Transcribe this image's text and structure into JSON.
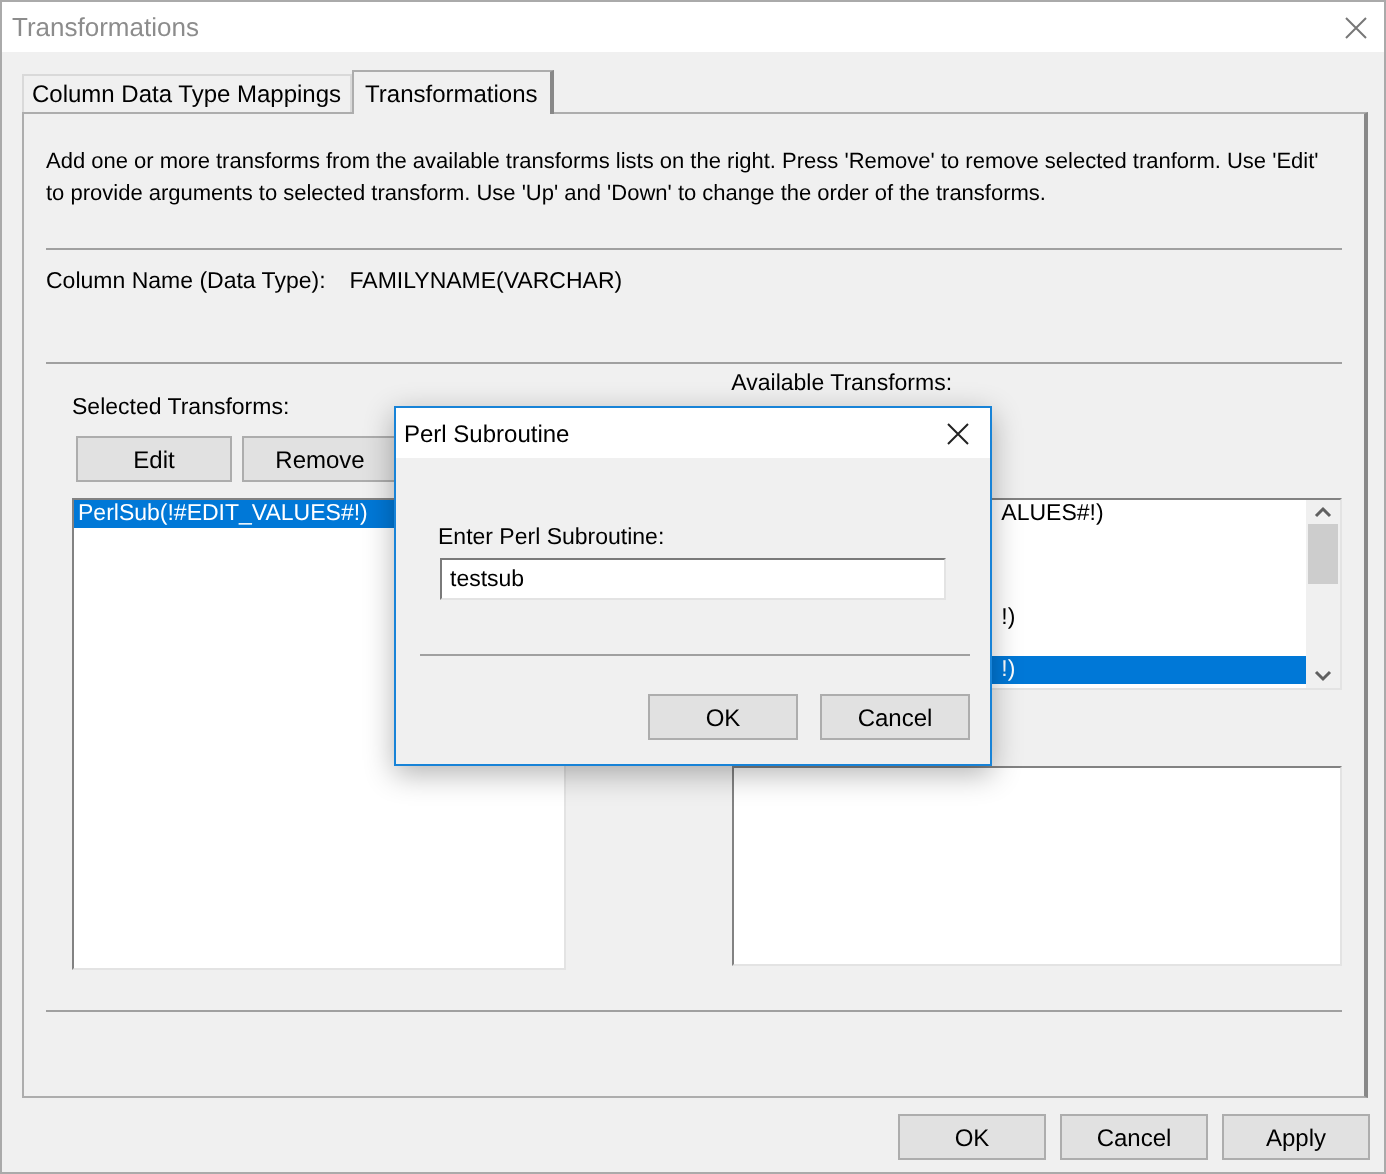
{
  "window": {
    "title": "Transformations"
  },
  "tabs": [
    {
      "label": "Column Data Type Mappings",
      "selected": false
    },
    {
      "label": "Transformations",
      "selected": true
    }
  ],
  "description": "Add one or more transforms from the available transforms lists on the right. Press 'Remove' to remove selected tranform. Use 'Edit' to provide arguments to selected transform. Use 'Up' and 'Down' to change the order of the transforms.",
  "column_name": {
    "label": "Column Name (Data Type):",
    "value": "FAMILYNAME(VARCHAR)"
  },
  "selected_transforms": {
    "label": "Selected Transforms:",
    "buttons": [
      "Edit",
      "Remove"
    ],
    "items": [
      {
        "label": "PerlSub(!#EDIT_VALUES#!)",
        "selected": true
      }
    ]
  },
  "available_transforms": {
    "label": "Available Transforms:",
    "items": [
      {
        "label": "ALUES#!)",
        "selected": false
      },
      {
        "label": "!)",
        "selected": false
      },
      {
        "label": "!)",
        "selected": true
      }
    ]
  },
  "buttons": [
    "OK",
    "Cancel",
    "Apply"
  ],
  "dialog": {
    "title": "Perl Subroutine",
    "field_label": "Enter Perl Subroutine:",
    "value": "testsub",
    "buttons": [
      "OK",
      "Cancel"
    ]
  }
}
